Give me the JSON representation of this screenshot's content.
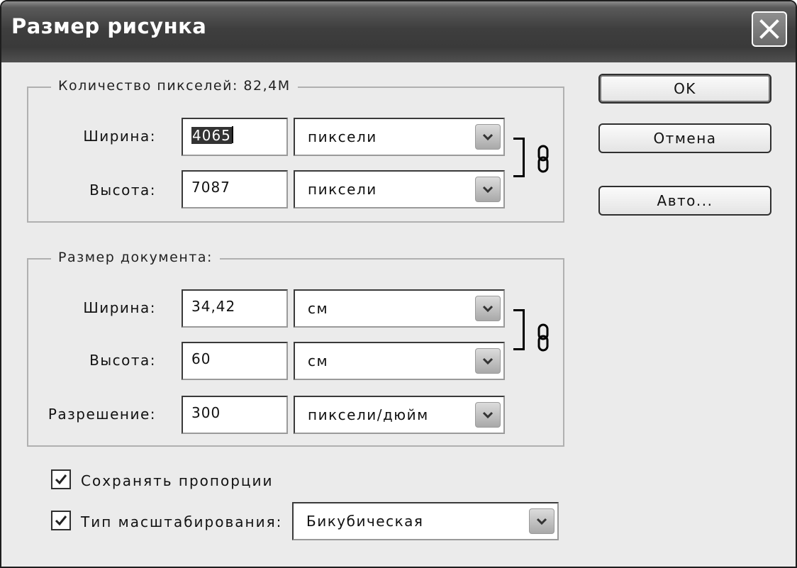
{
  "window": {
    "title": "Размер рисунка"
  },
  "pixel_dimensions": {
    "legend": "Количество пикселей: 82,4М",
    "width": {
      "label": "Ширина:",
      "value": "4065",
      "unit": "пиксели"
    },
    "height": {
      "label": "Высота:",
      "value": "7087",
      "unit": "пиксели"
    }
  },
  "document_size": {
    "legend": "Размер документа:",
    "width": {
      "label": "Ширина:",
      "value": "34,42",
      "unit": "см"
    },
    "height": {
      "label": "Высота:",
      "value": "60",
      "unit": "см"
    },
    "resolution": {
      "label": "Разрешение:",
      "value": "300",
      "unit": "пиксели/дюйм"
    }
  },
  "buttons": {
    "ok": "OK",
    "cancel": "Отмена",
    "auto": "Авто..."
  },
  "options": {
    "constrain_proportions": {
      "label": "Сохранять пропорции",
      "checked": true
    },
    "resample": {
      "label": "Тип масштабирования:",
      "checked": true,
      "method": "Бикубическая"
    }
  },
  "icons": {
    "close": "close-icon",
    "link": "chain-link-icon",
    "dropdown": "chevron-down-icon",
    "check": "checkmark-icon"
  }
}
